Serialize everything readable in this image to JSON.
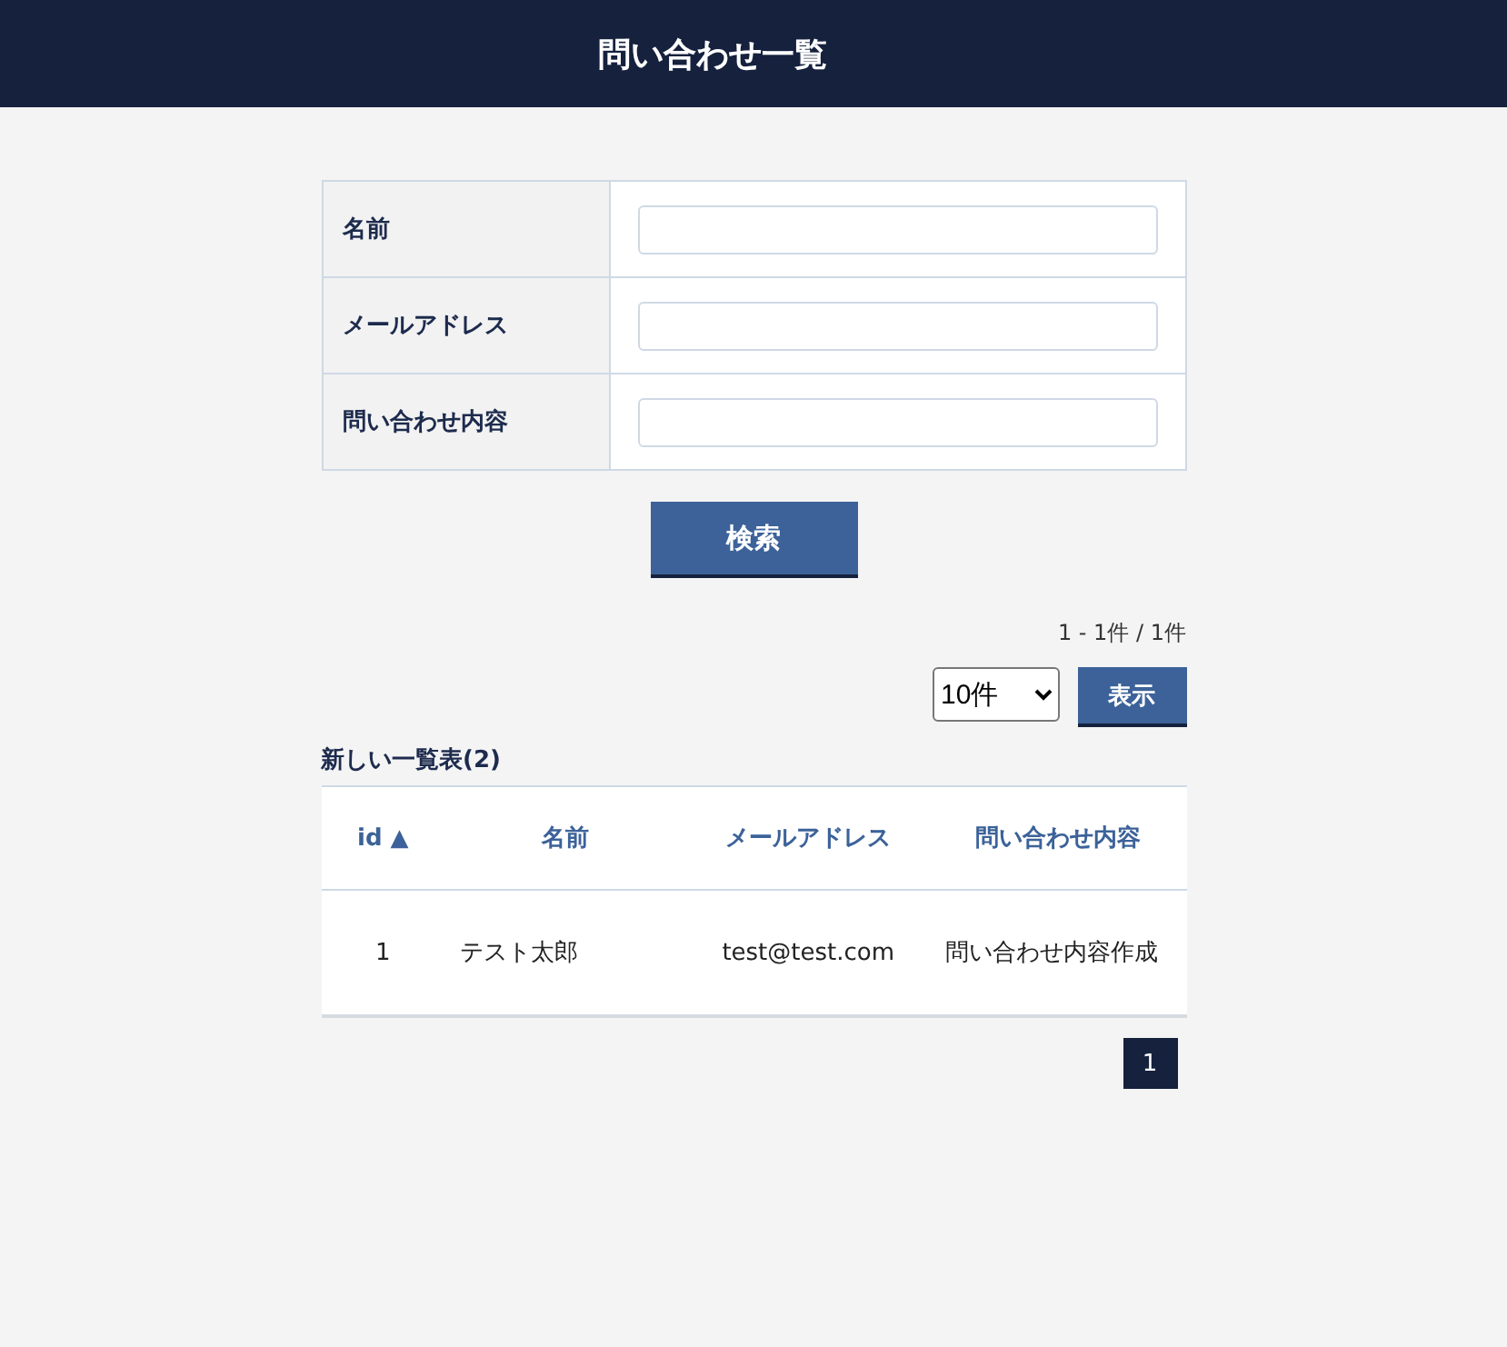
{
  "header": {
    "title": "問い合わせ一覧"
  },
  "search_form": {
    "fields": [
      {
        "label": "名前"
      },
      {
        "label": "メールアドレス"
      },
      {
        "label": "問い合わせ内容"
      }
    ],
    "button": "検索"
  },
  "result_count": "1 - 1件 / 1件",
  "per_page": {
    "value": "10件",
    "button": "表示"
  },
  "table": {
    "caption": "新しい一覧表(2)",
    "columns": [
      "id ▲",
      "名前",
      "メールアドレス",
      "問い合わせ内容"
    ],
    "rows": [
      [
        "1",
        "テスト太郎",
        "test@test.com",
        "問い合わせ内容作成"
      ]
    ]
  },
  "pagination": [
    {
      "label": "1",
      "selected": true
    }
  ]
}
